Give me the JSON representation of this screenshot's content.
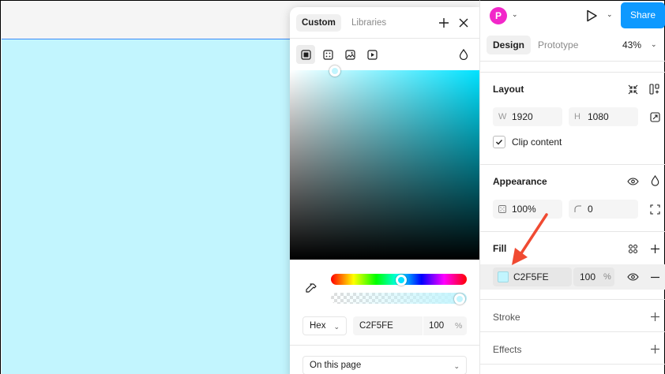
{
  "colors": {
    "fill": "#c2f5fe",
    "accent": "#0d99ff",
    "avatar": "#f227c9",
    "annotation": "#f04a32"
  },
  "picker": {
    "tabs": [
      "Custom",
      "Libraries"
    ],
    "add_icon": "plus-icon",
    "close_icon": "close-icon",
    "types": [
      "solid-fill-icon",
      "gradient-icon",
      "image-icon",
      "video-icon"
    ],
    "blend_icon": "drop-icon",
    "hue_pct": 0.52,
    "alpha_pct": 1.0,
    "format": "Hex",
    "hex": "C2F5FE",
    "alpha": "100",
    "alpha_unit": "%",
    "library_scope": "On this page"
  },
  "toolbar": {
    "avatar_initial": "P",
    "share_label": "Share"
  },
  "panel": {
    "tabs": [
      "Design",
      "Prototype"
    ],
    "zoom": "43%",
    "layout": {
      "title": "Layout",
      "width_label": "W",
      "width": "1920",
      "height_label": "H",
      "height": "1080",
      "clip_label": "Clip content",
      "clip_checked": true
    },
    "appearance": {
      "title": "Appearance",
      "opacity": "100%",
      "radius": "0"
    },
    "fill": {
      "title": "Fill",
      "hex": "C2F5FE",
      "alpha": "100",
      "alpha_unit": "%"
    },
    "stroke_title": "Stroke",
    "effects_title": "Effects"
  }
}
